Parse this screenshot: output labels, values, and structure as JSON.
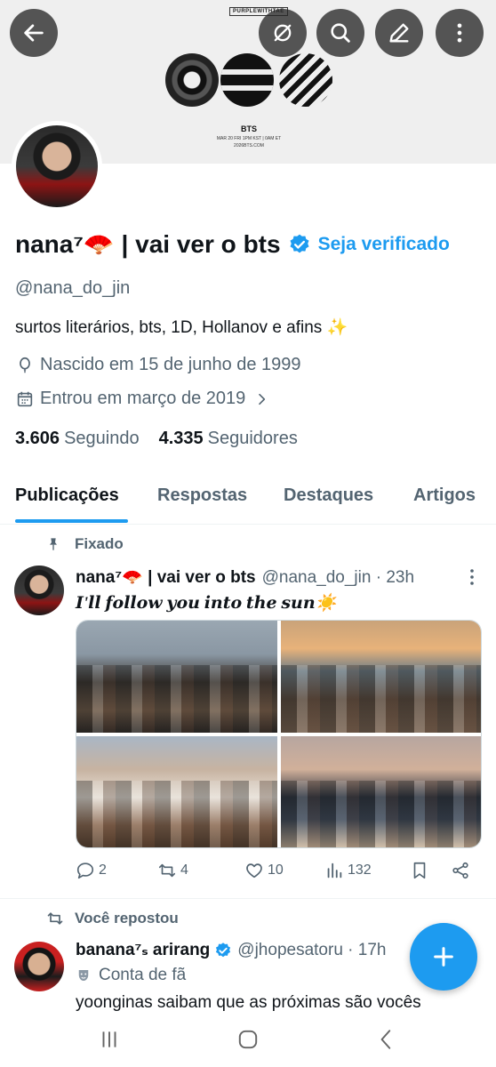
{
  "banner": {
    "tag": "PURPLEWITHTAE",
    "title": "BTS",
    "line1": "MAR 20 FRI 1PM KST | 0AM ET",
    "line2": "2026BTS.COM"
  },
  "profile": {
    "name": "nana⁷🪭 | vai ver o bts",
    "get_verified": "Seja verificado",
    "handle": "@nana_do_jin",
    "bio": "surtos literários, bts, 1D, Hollanov e afins ✨",
    "birth": "Nascido em 15 de junho de 1999",
    "joined": "Entrou em março de 2019",
    "following_count": "3.606",
    "following_label": "Seguindo",
    "followers_count": "4.335",
    "followers_label": "Seguidores"
  },
  "tabs": [
    "Publicações",
    "Respostas",
    "Destaques",
    "Artigos"
  ],
  "pinned_tweet": {
    "pinned_label": "Fixado",
    "name": "nana⁷🪭 | vai ver o bts",
    "handle_time": "@nana_do_jin · 23h",
    "text": "𝑰'𝒍𝒍 𝒇𝒐𝒍𝒍𝒐𝒘 𝒚𝒐𝒖 𝒊𝒏𝒕𝒐 𝒕𝒉𝒆 𝒔𝒖𝒏☀️",
    "replies": "2",
    "reposts": "4",
    "likes": "10",
    "views": "132"
  },
  "repost_tweet": {
    "repost_label": "Você repostou",
    "name": "banana⁷ₛ arirang",
    "handle_time": "@jhopesatoru · 17h",
    "fan_label": "Conta de fã",
    "text": "yoonginas saibam que as próximas são vocês"
  },
  "colors": {
    "accent": "#1d9bf0",
    "text_primary": "#0f1419",
    "text_secondary": "#536471"
  }
}
